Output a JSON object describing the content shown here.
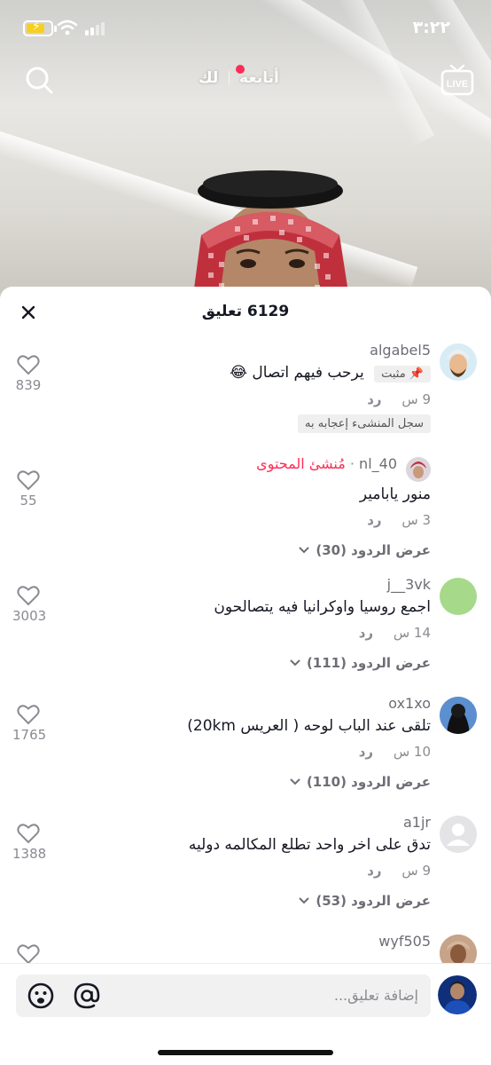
{
  "status_bar": {
    "time": "٣:٢٢"
  },
  "top_nav": {
    "for_you_tab": "لك",
    "following_tab": "أتابعه",
    "live_label": "LIVE",
    "search_icon": "search-icon",
    "live_icon": "live-tv-icon"
  },
  "sheet": {
    "title": "6129 تعليق",
    "close_icon": "close-icon"
  },
  "comments": [
    {
      "username": "algabel5",
      "pinned_label": "مثبت",
      "text": "يرحب فيهم اتصال 😂",
      "time": "9 س",
      "reply_label": "رد",
      "creator_liked": "سجل المنشىء إعجابه به",
      "likes": "839"
    },
    {
      "username": "nl_40",
      "creator_label": "مُنشئ المحتوى",
      "text": "منور يابامير",
      "time": "3 س",
      "reply_label": "رد",
      "view_replies": "عرض الردود (30)",
      "likes": "55"
    },
    {
      "username": "j__3vk",
      "text": "اجمع روسيا واوكرانيا فيه يتصالحون",
      "time": "14 س",
      "reply_label": "رد",
      "view_replies": "عرض الردود (111)",
      "likes": "3003"
    },
    {
      "username": "ox1xo",
      "text": "تلقى عند الباب لوحه ( العريس 20km)",
      "time": "10 س",
      "reply_label": "رد",
      "view_replies": "عرض الردود (110)",
      "likes": "1765"
    },
    {
      "username": "a1jr",
      "text": "تدق على اخر واحد تطلع المكالمه دوليه",
      "time": "9 س",
      "reply_label": "رد",
      "view_replies": "عرض الردود (53)",
      "likes": "1388"
    },
    {
      "username": "wyf505",
      "text": "",
      "likes": ""
    }
  ],
  "input": {
    "placeholder": "إضافة تعليق...",
    "emoji_icon": "emoji-icon",
    "mention_icon": "mention-icon"
  },
  "colors": {
    "accent": "#fe2c55",
    "text_primary": "#161823",
    "text_secondary": "#8a8b91",
    "input_bg": "#f1f1f2"
  }
}
